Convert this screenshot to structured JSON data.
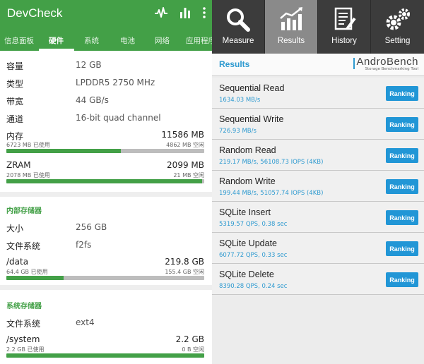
{
  "devcheck": {
    "title": "DevCheck",
    "tabs": [
      "信息面板",
      "硬件",
      "系统",
      "电池",
      "网络",
      "应用程序"
    ],
    "active_tab": 1,
    "memory_specs": [
      {
        "key": "容量",
        "value": "12 GB"
      },
      {
        "key": "类型",
        "value": "LPDDR5 2750 MHz"
      },
      {
        "key": "带宽",
        "value": "44 GB/s"
      },
      {
        "key": "通道",
        "value": "16-bit quad channel"
      }
    ],
    "ram": {
      "label": "内存",
      "total": "11586 MB",
      "used": "6723 MB 已使用",
      "free": "4862 MB 空闲",
      "used_fraction": 0.58
    },
    "zram": {
      "label": "ZRAM",
      "total": "2099 MB",
      "used": "2078 MB 已使用",
      "free": "21 MB 空闲",
      "used_fraction": 0.99
    },
    "internal_storage": {
      "title": "内部存储器",
      "size_key": "大小",
      "size_value": "256 GB",
      "fs_key": "文件系统",
      "fs_value": "f2fs",
      "data": {
        "label": "/data",
        "total": "219.8 GB",
        "used": "64.4 GB 已使用",
        "free": "155.4 GB 空闲",
        "used_fraction": 0.29
      }
    },
    "system_storage": {
      "title": "系统存储器",
      "fs_key": "文件系统",
      "fs_value": "ext4",
      "system": {
        "label": "/system",
        "total": "2.2 GB",
        "used": "2.2 GB 已使用",
        "free": "0 B 空闲",
        "used_fraction": 1.0
      }
    }
  },
  "androbench": {
    "tabs": [
      "Measure",
      "Results",
      "History",
      "Setting"
    ],
    "active_tab": 1,
    "results_title": "Results",
    "logo_name": "AndroBench",
    "logo_sub": "Storage Benchmarking Tool",
    "ranking_label": "Ranking",
    "results": [
      {
        "name": "Sequential Read",
        "value": "1634.03 MB/s"
      },
      {
        "name": "Sequential Write",
        "value": "726.93 MB/s"
      },
      {
        "name": "Random Read",
        "value": "219.17 MB/s, 56108.73 IOPS (4KB)"
      },
      {
        "name": "Random Write",
        "value": "199.44 MB/s, 51057.74 IOPS (4KB)"
      },
      {
        "name": "SQLite Insert",
        "value": "5319.57 QPS, 0.38 sec"
      },
      {
        "name": "SQLite Update",
        "value": "6077.72 QPS, 0.33 sec"
      },
      {
        "name": "SQLite Delete",
        "value": "8390.28 QPS, 0.24 sec"
      }
    ]
  },
  "colors": {
    "devcheck_green": "#43a047",
    "androbench_blue": "#2196d6"
  }
}
